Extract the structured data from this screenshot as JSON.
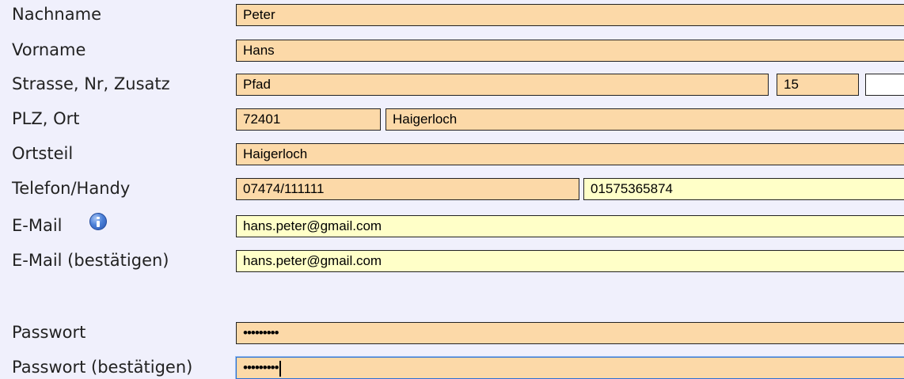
{
  "form": {
    "nachname": {
      "label": "Nachname",
      "value": "Peter"
    },
    "vorname": {
      "label": "Vorname",
      "value": "Hans"
    },
    "strasse": {
      "label": "Strasse, Nr, Zusatz",
      "street": "Pfad",
      "number": "15",
      "addition": ""
    },
    "plz_ort": {
      "label": "PLZ, Ort",
      "plz": "72401",
      "ort": "Haigerloch"
    },
    "ortsteil": {
      "label": "Ortsteil",
      "value": "Haigerloch"
    },
    "telefon": {
      "label": "Telefon/Handy",
      "phone": "07474/111111",
      "mobile": "01575365874"
    },
    "email": {
      "label": "E-Mail",
      "value": "hans.peter@gmail.com",
      "info_icon": "info-icon"
    },
    "email_confirm": {
      "label": "E-Mail (bestätigen)",
      "value": "hans.peter@gmail.com"
    },
    "passwort": {
      "label": "Passwort",
      "value": "•••••••••"
    },
    "passwort_confirm": {
      "label": "Passwort (bestätigen)",
      "value": "•••••••••"
    }
  },
  "colors": {
    "background": "#f0f0fc",
    "field_required": "#fcd9a8",
    "field_optional": "#ffffc8",
    "field_focus_border": "#2b6fd6"
  }
}
